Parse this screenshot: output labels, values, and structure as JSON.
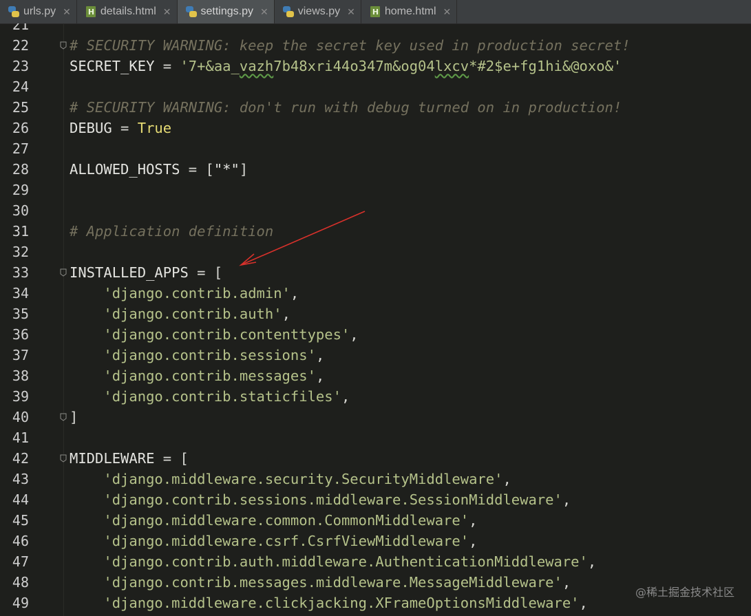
{
  "tabs": [
    {
      "label": "urls.py",
      "icon": "python-file-icon",
      "active": false
    },
    {
      "label": "details.html",
      "icon": "html-file-icon",
      "active": false
    },
    {
      "label": "settings.py",
      "icon": "python-file-icon",
      "active": true
    },
    {
      "label": "views.py",
      "icon": "python-file-icon",
      "active": false
    },
    {
      "label": "home.html",
      "icon": "html-file-icon",
      "active": false
    }
  ],
  "editor": {
    "file": "settings.py",
    "lines": [
      {
        "n": "21",
        "tokens": []
      },
      {
        "n": "22",
        "fold": true,
        "tokens": [
          {
            "t": "# SECURITY WARNING: keep the secret key used in production secret!",
            "c": "comment"
          }
        ]
      },
      {
        "n": "23",
        "tokens": [
          {
            "t": "SECRET_KEY",
            "c": "ident"
          },
          {
            "t": " = ",
            "c": "op"
          },
          {
            "t": "'7+&aa_",
            "c": "string"
          },
          {
            "t": "vazh",
            "c": "string squiggle"
          },
          {
            "t": "7b48xri44o347m&og04",
            "c": "string"
          },
          {
            "t": "lxcv",
            "c": "string squiggle"
          },
          {
            "t": "*#2$e+fg1hi&@oxo&'",
            "c": "string"
          }
        ]
      },
      {
        "n": "24",
        "tokens": []
      },
      {
        "n": "25",
        "tokens": [
          {
            "t": "# SECURITY WARNING: don't run with debug turned on in production!",
            "c": "comment"
          }
        ]
      },
      {
        "n": "26",
        "tokens": [
          {
            "t": "DEBUG",
            "c": "ident"
          },
          {
            "t": " = ",
            "c": "op"
          },
          {
            "t": "True",
            "c": "const"
          }
        ]
      },
      {
        "n": "27",
        "tokens": []
      },
      {
        "n": "28",
        "tokens": [
          {
            "t": "ALLOWED_HOSTS",
            "c": "ident"
          },
          {
            "t": " = [",
            "c": "op"
          },
          {
            "t": "\"*\"",
            "c": "ident"
          },
          {
            "t": "]",
            "c": "op"
          }
        ]
      },
      {
        "n": "29",
        "tokens": []
      },
      {
        "n": "30",
        "tokens": []
      },
      {
        "n": "31",
        "tokens": [
          {
            "t": "# Application definition",
            "c": "comment"
          }
        ]
      },
      {
        "n": "32",
        "tokens": []
      },
      {
        "n": "33",
        "fold": true,
        "tokens": [
          {
            "t": "INSTALLED_APPS",
            "c": "ident"
          },
          {
            "t": " = [",
            "c": "op"
          }
        ]
      },
      {
        "n": "34",
        "tokens": [
          {
            "t": "    ",
            "c": "op"
          },
          {
            "t": "'django.contrib.admin'",
            "c": "string"
          },
          {
            "t": ",",
            "c": "op"
          }
        ]
      },
      {
        "n": "35",
        "tokens": [
          {
            "t": "    ",
            "c": "op"
          },
          {
            "t": "'django.contrib.auth'",
            "c": "string"
          },
          {
            "t": ",",
            "c": "op"
          }
        ]
      },
      {
        "n": "36",
        "tokens": [
          {
            "t": "    ",
            "c": "op"
          },
          {
            "t": "'django.contrib.contenttypes'",
            "c": "string"
          },
          {
            "t": ",",
            "c": "op"
          }
        ]
      },
      {
        "n": "37",
        "tokens": [
          {
            "t": "    ",
            "c": "op"
          },
          {
            "t": "'django.contrib.sessions'",
            "c": "string"
          },
          {
            "t": ",",
            "c": "op"
          }
        ]
      },
      {
        "n": "38",
        "tokens": [
          {
            "t": "    ",
            "c": "op"
          },
          {
            "t": "'django.contrib.messages'",
            "c": "string"
          },
          {
            "t": ",",
            "c": "op"
          }
        ]
      },
      {
        "n": "39",
        "tokens": [
          {
            "t": "    ",
            "c": "op"
          },
          {
            "t": "'django.contrib.staticfiles'",
            "c": "string"
          },
          {
            "t": ",",
            "c": "op"
          }
        ]
      },
      {
        "n": "40",
        "fold": true,
        "tokens": [
          {
            "t": "]",
            "c": "op"
          }
        ]
      },
      {
        "n": "41",
        "tokens": []
      },
      {
        "n": "42",
        "fold": true,
        "tokens": [
          {
            "t": "MIDDLEWARE",
            "c": "ident"
          },
          {
            "t": " = [",
            "c": "op"
          }
        ]
      },
      {
        "n": "43",
        "tokens": [
          {
            "t": "    ",
            "c": "op"
          },
          {
            "t": "'django.middleware.security.SecurityMiddleware'",
            "c": "string"
          },
          {
            "t": ",",
            "c": "op"
          }
        ]
      },
      {
        "n": "44",
        "tokens": [
          {
            "t": "    ",
            "c": "op"
          },
          {
            "t": "'django.contrib.sessions.middleware.SessionMiddleware'",
            "c": "string"
          },
          {
            "t": ",",
            "c": "op"
          }
        ]
      },
      {
        "n": "45",
        "tokens": [
          {
            "t": "    ",
            "c": "op"
          },
          {
            "t": "'django.middleware.common.CommonMiddleware'",
            "c": "string"
          },
          {
            "t": ",",
            "c": "op"
          }
        ]
      },
      {
        "n": "46",
        "tokens": [
          {
            "t": "    ",
            "c": "op"
          },
          {
            "t": "'django.middleware.csrf.CsrfViewMiddleware'",
            "c": "string"
          },
          {
            "t": ",",
            "c": "op"
          }
        ]
      },
      {
        "n": "47",
        "tokens": [
          {
            "t": "    ",
            "c": "op"
          },
          {
            "t": "'django.contrib.auth.middleware.AuthenticationMiddleware'",
            "c": "string"
          },
          {
            "t": ",",
            "c": "op"
          }
        ]
      },
      {
        "n": "48",
        "tokens": [
          {
            "t": "    ",
            "c": "op"
          },
          {
            "t": "'django.contrib.messages.middleware.MessageMiddleware'",
            "c": "string"
          },
          {
            "t": ",",
            "c": "op"
          }
        ]
      },
      {
        "n": "49",
        "tokens": [
          {
            "t": "    ",
            "c": "op"
          },
          {
            "t": "'django.middleware.clickjacking.XFrameOptionsMiddleware'",
            "c": "string"
          },
          {
            "t": ",",
            "c": "op"
          }
        ]
      }
    ]
  },
  "annotation": {
    "color": "#d9312b",
    "points_to": "INSTALLED_APPS"
  },
  "watermark": "@稀土掘金技术社区",
  "colors": {
    "background": "#1e1f1c",
    "comment": "#75715e",
    "string": "#b5c28a",
    "constant": "#e6db74",
    "tab_active": "#4e5254"
  }
}
